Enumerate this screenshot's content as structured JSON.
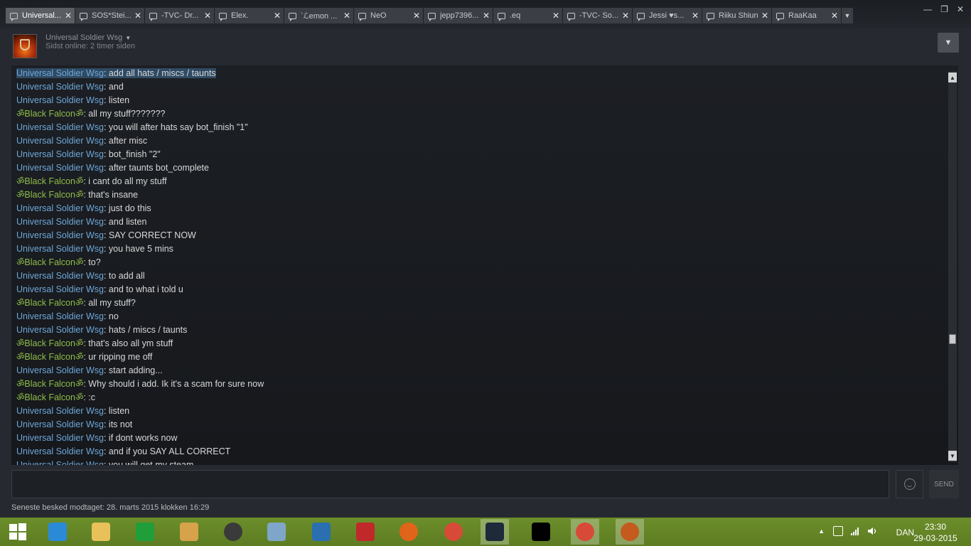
{
  "tabs": [
    {
      "label": "Universal...",
      "active": true
    },
    {
      "label": "SOS*Stei...",
      "active": false
    },
    {
      "label": "-TVC- Dr...",
      "active": false
    },
    {
      "label": "Elex.",
      "active": false
    },
    {
      "label": "`ℒemon ...",
      "active": false
    },
    {
      "label": "NeO",
      "active": false
    },
    {
      "label": "jepp7396...",
      "active": false
    },
    {
      "label": ".eq",
      "active": false
    },
    {
      "label": "-TVC- So...",
      "active": false
    },
    {
      "label": "Jessi ♥s...",
      "active": false
    },
    {
      "label": "Riiku Shiun",
      "active": false
    },
    {
      "label": "RaaKaa",
      "active": false
    }
  ],
  "header": {
    "friend_name": "Universal Soldier Wsg",
    "status": "Sidst online: 2 timer siden"
  },
  "messages": [
    {
      "sender": "Universal Soldier Wsg",
      "text": ": add all hats / miscs / taunts",
      "me": false,
      "highlighted": true
    },
    {
      "sender": "Universal Soldier Wsg",
      "text": ": and",
      "me": false
    },
    {
      "sender": "Universal Soldier Wsg",
      "text": ": listen",
      "me": false
    },
    {
      "sender": "ॐBlack Falconॐ",
      "text": ": all my stuff???????",
      "me": true
    },
    {
      "sender": "Universal Soldier Wsg",
      "text": ": you will after hats say bot_finish \"1\"",
      "me": false
    },
    {
      "sender": "Universal Soldier Wsg",
      "text": ": after misc",
      "me": false
    },
    {
      "sender": "Universal Soldier Wsg",
      "text": ": bot_finish \"2\"",
      "me": false
    },
    {
      "sender": "Universal Soldier Wsg",
      "text": ": after taunts bot_complete",
      "me": false
    },
    {
      "sender": "ॐBlack Falconॐ",
      "text": ": i cant do all my stuff",
      "me": true
    },
    {
      "sender": "ॐBlack Falconॐ",
      "text": ": that's insane",
      "me": true
    },
    {
      "sender": "Universal Soldier Wsg",
      "text": ": just do this",
      "me": false
    },
    {
      "sender": "Universal Soldier Wsg",
      "text": ": and listen",
      "me": false
    },
    {
      "sender": "Universal Soldier Wsg",
      "text": ": SAY CORRECT NOW",
      "me": false
    },
    {
      "sender": "Universal Soldier Wsg",
      "text": ": you have 5 mins",
      "me": false
    },
    {
      "sender": "ॐBlack Falconॐ",
      "text": ": to?",
      "me": true
    },
    {
      "sender": "Universal Soldier Wsg",
      "text": ": to add all",
      "me": false
    },
    {
      "sender": "Universal Soldier Wsg",
      "text": ": and to what i told u",
      "me": false
    },
    {
      "sender": "ॐBlack Falconॐ",
      "text": ": all my stuff?",
      "me": true
    },
    {
      "sender": "Universal Soldier Wsg",
      "text": ": no",
      "me": false
    },
    {
      "sender": "Universal Soldier Wsg",
      "text": ": hats / miscs / taunts",
      "me": false
    },
    {
      "sender": "ॐBlack Falconॐ",
      "text": ": that's also all ym stuff",
      "me": true
    },
    {
      "sender": "ॐBlack Falconॐ",
      "text": ": ur ripping me off",
      "me": true
    },
    {
      "sender": "Universal Soldier Wsg",
      "text": ": start adding...",
      "me": false
    },
    {
      "sender": "ॐBlack Falconॐ",
      "text": ": Why should i add. Ik it's a scam for sure now",
      "me": true
    },
    {
      "sender": "ॐBlack Falconॐ",
      "text": ": :c",
      "me": true
    },
    {
      "sender": "Universal Soldier Wsg",
      "text": ": listen",
      "me": false
    },
    {
      "sender": "Universal Soldier Wsg",
      "text": ": its not",
      "me": false
    },
    {
      "sender": "Universal Soldier Wsg",
      "text": ": if dont works now",
      "me": false
    },
    {
      "sender": "Universal Soldier Wsg",
      "text": ": and if you SAY ALL CORRECT",
      "me": false
    },
    {
      "sender": "Universal Soldier Wsg",
      "text": ": you will get my steam",
      "me": false
    }
  ],
  "input": {
    "value": "",
    "send_label": "SEND"
  },
  "footer": {
    "last_received": "Seneste besked modtaget: 28. marts 2015 klokken 16:29"
  },
  "colors": {
    "sender_other": "#6ea7d8",
    "sender_me": "#8fbc4a",
    "taskbar": "#6c8e2a"
  },
  "taskbar": {
    "icons": [
      {
        "name": "start-icon",
        "color": "#ffffff",
        "active": false
      },
      {
        "name": "internet-explorer-icon",
        "color": "#2a8ad8",
        "active": false
      },
      {
        "name": "file-explorer-icon",
        "color": "#e8c15a",
        "active": false
      },
      {
        "name": "store-icon",
        "color": "#1f9e3a",
        "active": false
      },
      {
        "name": "app-gear-icon",
        "color": "#d6a24a",
        "active": false
      },
      {
        "name": "speaker-app-icon",
        "color": "#3a3a3a",
        "active": false
      },
      {
        "name": "document-app-icon",
        "color": "#7fa6c8",
        "active": false
      },
      {
        "name": "settings-app-icon",
        "color": "#2a6fb0",
        "active": false
      },
      {
        "name": "power-app-icon",
        "color": "#c0282a",
        "active": false
      },
      {
        "name": "firefox-icon",
        "color": "#e0641a",
        "active": false
      },
      {
        "name": "chrome-icon",
        "color": "#d84a38",
        "active": false
      },
      {
        "name": "steam-icon",
        "color": "#1e2a3a",
        "active": true
      },
      {
        "name": "command-prompt-icon",
        "color": "#000000",
        "active": false
      },
      {
        "name": "chrome-icon",
        "color": "#d84a38",
        "active": true
      },
      {
        "name": "team-fortress-icon",
        "color": "#c45a1e",
        "active": true
      }
    ],
    "tray": {
      "language": "DAN",
      "time": "23:30",
      "date": "29-03-2015"
    }
  }
}
